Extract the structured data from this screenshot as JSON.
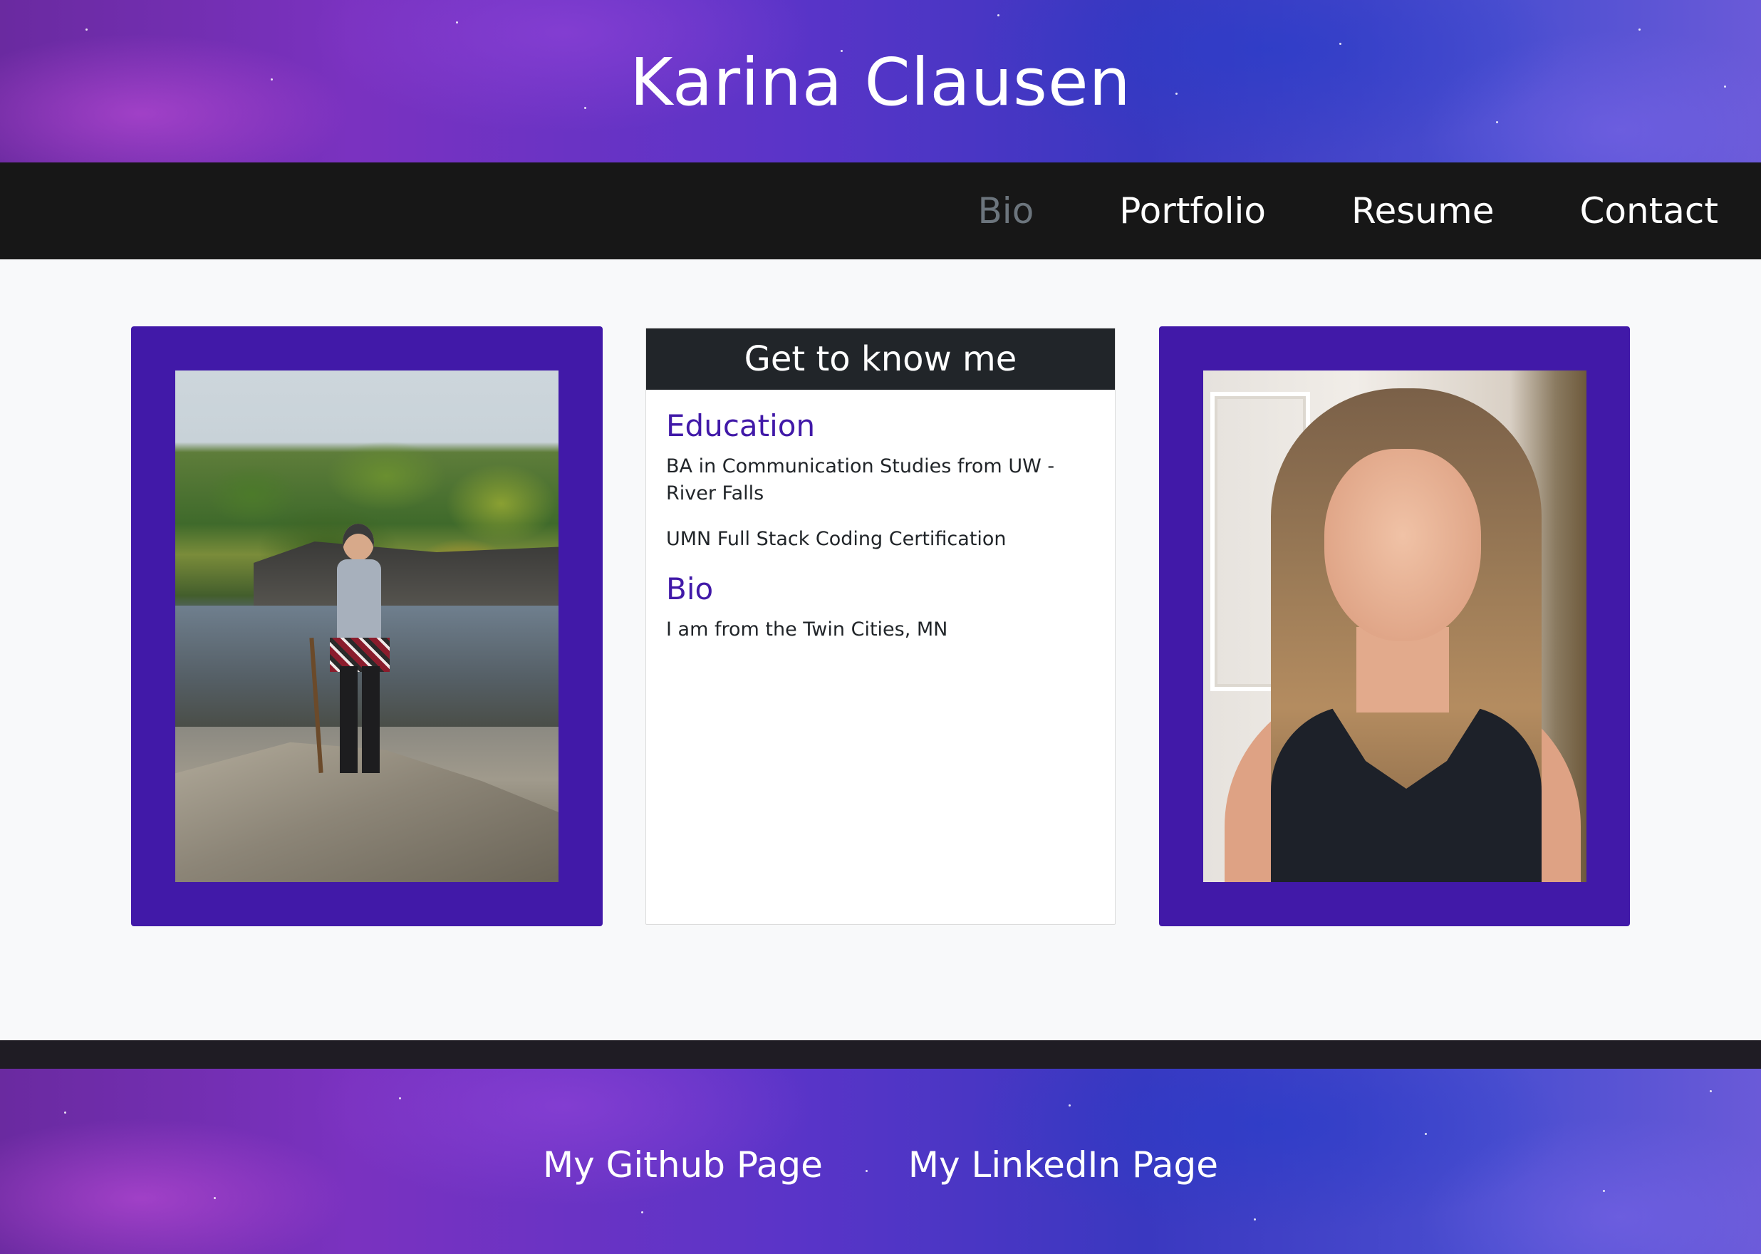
{
  "header": {
    "title": "Karina Clausen"
  },
  "nav": {
    "items": [
      {
        "label": "Bio",
        "active": true
      },
      {
        "label": "Portfolio",
        "active": false
      },
      {
        "label": "Resume",
        "active": false
      },
      {
        "label": "Contact",
        "active": false
      }
    ]
  },
  "card": {
    "header": "Get to know me",
    "sections": [
      {
        "heading": "Education",
        "paragraphs": [
          "BA in Communication Studies from UW - River Falls",
          "UMN Full Stack Coding Certification"
        ]
      },
      {
        "heading": "Bio",
        "paragraphs": [
          "I am from the Twin Cities, MN"
        ]
      }
    ]
  },
  "footer": {
    "links": [
      {
        "label": "My Github Page"
      },
      {
        "label": "My LinkedIn Page"
      }
    ]
  },
  "colors": {
    "accent": "#4119a8",
    "navbar": "#171717",
    "card_header": "#212529",
    "nav_active": "#6c757d"
  }
}
